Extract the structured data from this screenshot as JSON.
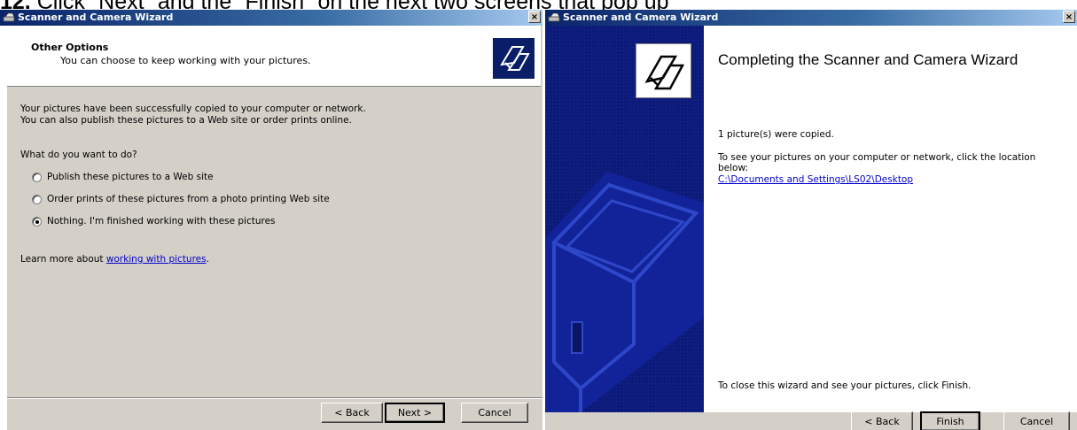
{
  "heading": {
    "number": "12.",
    "text": " Click “Next” and the “Finish” on the next two screens that pop up"
  },
  "left_window": {
    "title": "Scanner and Camera Wizard",
    "close_glyph": "×",
    "header_title": "Other Options",
    "header_subtitle": "You can choose to keep working with your pictures.",
    "intro_line1": "Your pictures have been successfully copied to your computer or network.",
    "intro_line2": "You can also publish these pictures to a Web site or order prints online.",
    "question": "What do you want to do?",
    "options": [
      {
        "label": "Publish these pictures to a Web site",
        "checked": false
      },
      {
        "label": "Order prints of these pictures from a photo printing Web site",
        "checked": false
      },
      {
        "label": "Nothing. I'm finished working with these pictures",
        "checked": true
      }
    ],
    "learn_more_prefix": "Learn more about ",
    "learn_more_link": "working with pictures",
    "learn_more_suffix": ".",
    "buttons": {
      "back": "< Back",
      "next": "Next >",
      "cancel": "Cancel"
    }
  },
  "right_window": {
    "title": "Scanner and Camera Wizard",
    "close_glyph": "×",
    "heading": "Completing the Scanner and Camera Wizard",
    "copied_text": "1 picture(s) were copied.",
    "location_text": "To see your pictures on your computer or network, click the location below:",
    "location_link": "C:\\Documents and Settings\\LS02\\Desktop",
    "close_text": "To close this wizard and see your pictures, click Finish.",
    "buttons": {
      "back": "< Back",
      "finish": "Finish",
      "cancel": "Cancel"
    }
  },
  "colors": {
    "wizard_blue": "#0c1a7a",
    "dialog_gray": "#d4d0c8",
    "link_blue": "#0000cc"
  }
}
